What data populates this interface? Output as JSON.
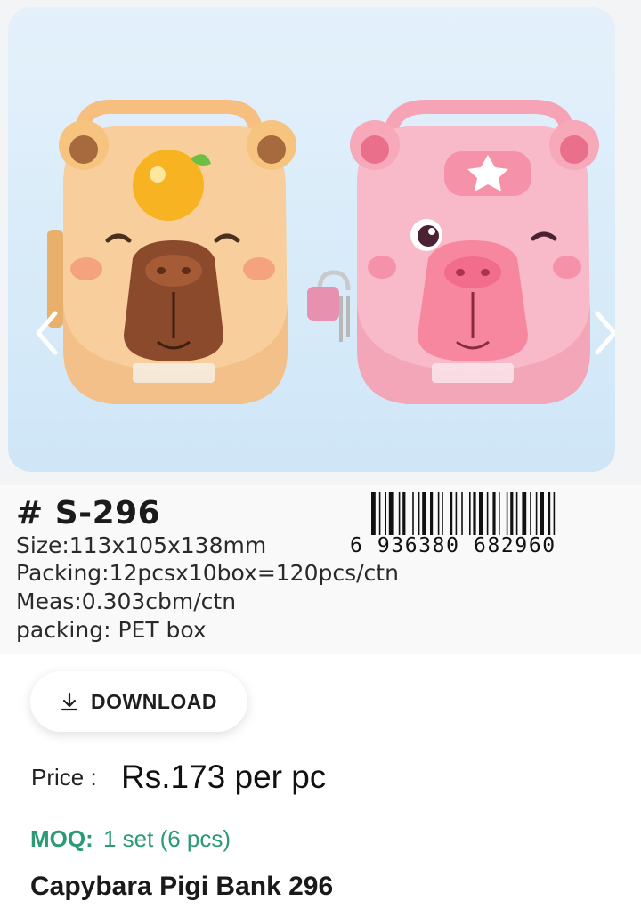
{
  "hero": {
    "image_alt": "Capybara piggy banks in orange and pink",
    "prev_icon": "chevron-left-icon",
    "next_icon": "chevron-right-icon"
  },
  "product": {
    "sku": "# S-296",
    "size": "Size:113x105x138mm",
    "packing_qty": "Packing:12pcsx10box=120pcs/ctn",
    "meas": "Meas:0.303cbm/ctn",
    "packing_type": "packing: PET box",
    "barcode": "6 936380 682960"
  },
  "download": {
    "label": "DOWNLOAD",
    "icon": "download-icon"
  },
  "price": {
    "label": "Price :",
    "value": "Rs.173 per pc"
  },
  "moq": {
    "label": "MOQ:",
    "value": "1 set (6 pcs)"
  },
  "title": "Capybara Pigi Bank 296"
}
